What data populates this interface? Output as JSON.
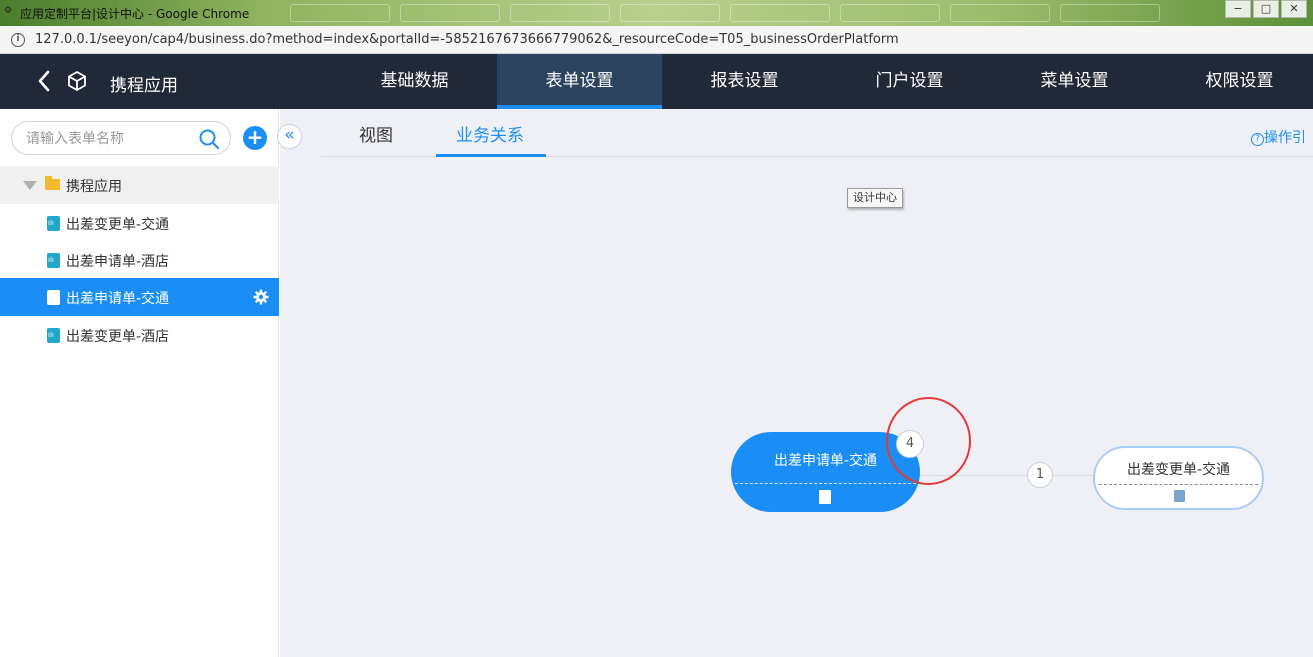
{
  "browser": {
    "window_title": "应用定制平台|设计中心 - Google Chrome",
    "url": "127.0.0.1/seeyon/cap4/business.do?method=index&portalId=-5852167673666779062&_resourceCode=T05_businessOrderPlatform",
    "window_buttons": [
      "−",
      "□",
      "✕"
    ]
  },
  "topnav": {
    "app_title": "携程应用",
    "menu": [
      {
        "label": "基础数据",
        "active": false
      },
      {
        "label": "表单设置",
        "active": true
      },
      {
        "label": "报表设置",
        "active": false
      },
      {
        "label": "门户设置",
        "active": false
      },
      {
        "label": "菜单设置",
        "active": false
      },
      {
        "label": "权限设置",
        "active": false
      }
    ]
  },
  "sidebar": {
    "search_placeholder": "请输入表单名称",
    "add_symbol": "+",
    "root_label": "携程应用",
    "items": [
      {
        "label": "出差变更单-交通",
        "icon": "chart-doc-icon",
        "active": false
      },
      {
        "label": "出差申请单-酒店",
        "icon": "chart-doc-icon",
        "active": false
      },
      {
        "label": "出差申请单-交通",
        "icon": "file-icon",
        "active": true
      },
      {
        "label": "出差变更单-酒店",
        "icon": "chart-doc-icon",
        "active": false
      }
    ]
  },
  "main": {
    "collapse_symbol": "«",
    "tabs": [
      {
        "label": "视图",
        "active": false
      },
      {
        "label": "业务关系",
        "active": true
      }
    ],
    "guide_icon_symbol": "?",
    "guide_label": "操作引",
    "tooltip": "设计中心"
  },
  "graph": {
    "main_node": {
      "label": "出差申请单-交通",
      "badge": "4"
    },
    "link_badge": "1",
    "secondary_node": {
      "label": "出差变更单-交通"
    }
  },
  "colors": {
    "accent": "#1a8ef5",
    "nav_bg": "#1f2938",
    "highlight": "#e53935"
  }
}
